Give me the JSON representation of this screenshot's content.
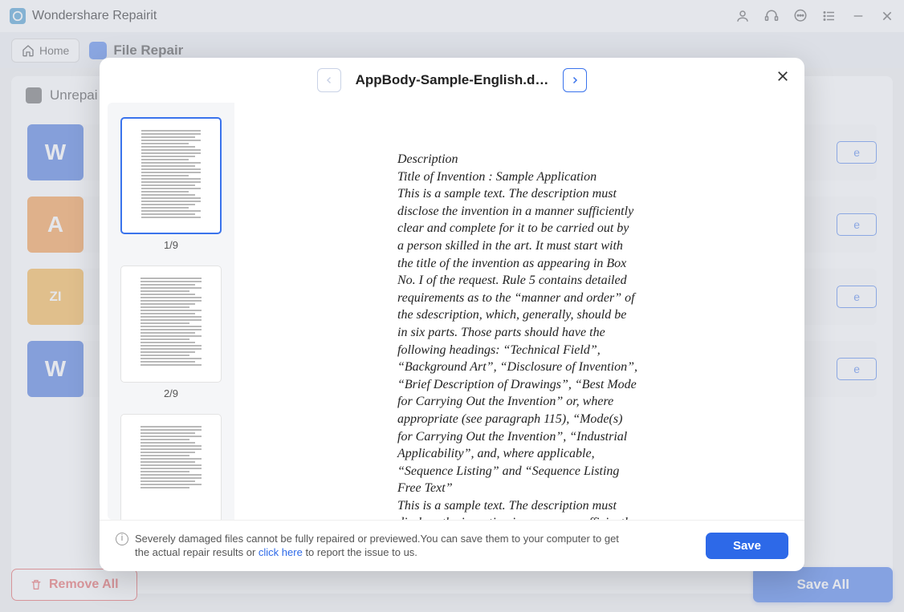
{
  "app": {
    "title": "Wondershare Repairit"
  },
  "toolbar": {
    "home": "Home",
    "crumb": "File Repair"
  },
  "panel": {
    "heading": "Unrepai"
  },
  "files": {
    "save_label": "e"
  },
  "footer": {
    "remove_all": "Remove All",
    "save_all": "Save All"
  },
  "modal": {
    "filename": "AppBody-Sample-English.d…",
    "thumbs": [
      "1/9",
      "2/9"
    ],
    "warning_pre": "Severely damaged files cannot be fully repaired or previewed.You can save them to your computer to get the actual repair results or ",
    "warning_link": "click here",
    "warning_post": " to report the issue to us.",
    "save": "Save"
  },
  "doc": {
    "p1": "Description",
    "p2": "Title of Invention : Sample Application",
    "p3": "This is a sample text. The description must disclose the invention in a manner sufficiently clear and complete for it to be carried out by a person skilled in the art. It must start with the title of the invention as appearing in Box No. I of the request. Rule 5 contains detailed requirements as to the “manner and order” of the sdescription, which, generally, should be in six parts. Those parts should have the following headings: “Technical Field”, “Background Art”, “Disclosure of Invention”, “Brief Description of Drawings”, “Best Mode for Carrying Out the Invention” or, where appropriate (see paragraph 115), “Mode(s) for Carrying Out the Invention”, “Industrial Applicability”, and, where applicable, “Sequence Listing” and “Sequence Listing Free Text”",
    "p4": "This is a sample text. The description must disclose the invention in a manner sufficiently clear and complete for it to be carried out by a person skilled in the art. It must start with the"
  }
}
